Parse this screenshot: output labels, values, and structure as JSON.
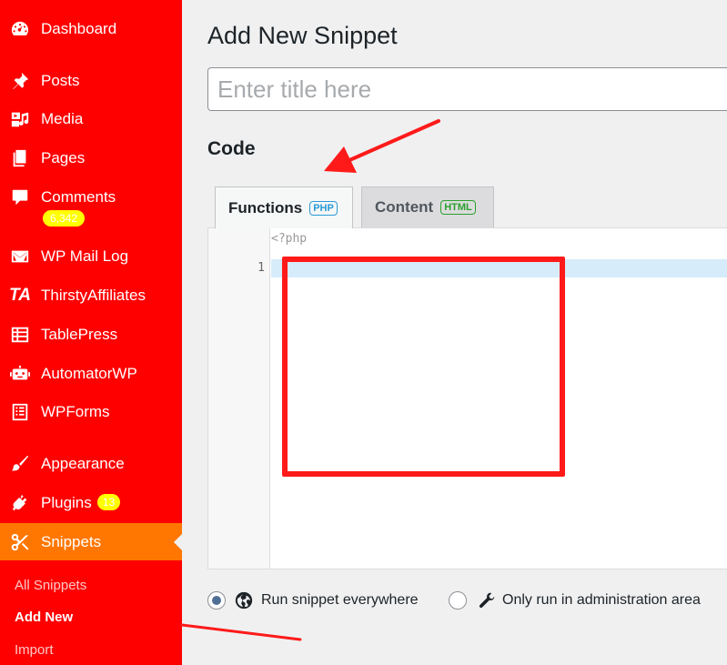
{
  "sidebar": {
    "items": [
      {
        "label": "Dashboard",
        "icon": "dashboard-icon"
      },
      {
        "label": "Posts",
        "icon": "pin-icon"
      },
      {
        "label": "Media",
        "icon": "media-icon"
      },
      {
        "label": "Pages",
        "icon": "pages-icon"
      },
      {
        "label": "Comments",
        "icon": "comment-icon",
        "badge": "6,342"
      },
      {
        "label": "WP Mail Log",
        "icon": "envelope-icon"
      },
      {
        "label": "ThirstyAffiliates",
        "icon": "ta-logo-icon",
        "icon_text": "TA"
      },
      {
        "label": "TablePress",
        "icon": "table-icon"
      },
      {
        "label": "AutomatorWP",
        "icon": "robot-icon"
      },
      {
        "label": "WPForms",
        "icon": "forms-icon"
      },
      {
        "label": "Appearance",
        "icon": "brush-icon"
      },
      {
        "label": "Plugins",
        "icon": "plug-icon",
        "badge": "13"
      },
      {
        "label": "Snippets",
        "icon": "scissors-icon",
        "current": true
      }
    ],
    "submenu": [
      {
        "label": "All Snippets"
      },
      {
        "label": "Add New",
        "current": true
      },
      {
        "label": "Import"
      }
    ],
    "colors": {
      "background": "#ff0000",
      "current": "#ff7700",
      "badge": "#ffff00"
    }
  },
  "main": {
    "page_title": "Add New Snippet",
    "title_placeholder": "Enter title here",
    "code_heading": "Code",
    "tabs": [
      {
        "label": "Functions",
        "badge": "PHP",
        "active": true
      },
      {
        "label": "Content",
        "badge": "HTML",
        "active": false
      }
    ],
    "editor": {
      "php_open_tag": "<?php",
      "line_numbers": [
        "1"
      ]
    },
    "scope": {
      "options": [
        {
          "label": "Run snippet everywhere",
          "icon": "globe-icon",
          "checked": true
        },
        {
          "label": "Only run in administration area",
          "icon": "wrench-icon",
          "checked": false
        }
      ]
    }
  },
  "annotation_color": "#ff1a1a"
}
